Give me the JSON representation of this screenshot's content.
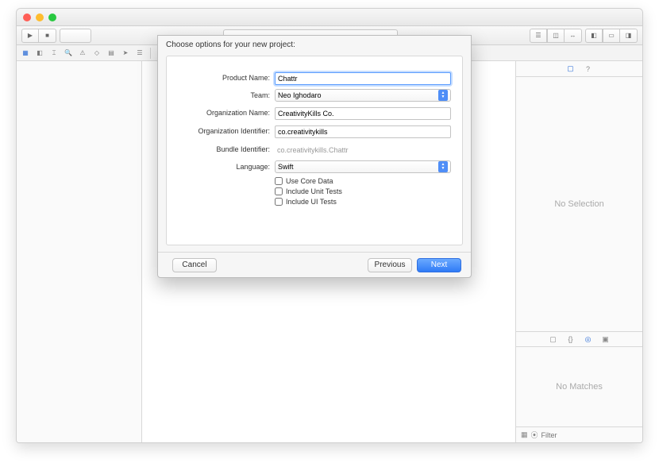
{
  "sheet": {
    "title": "Choose options for your new project:",
    "fields": {
      "productName": {
        "label": "Product Name:",
        "value": "Chattr"
      },
      "team": {
        "label": "Team:",
        "value": "Neo Ighodaro"
      },
      "orgName": {
        "label": "Organization Name:",
        "value": "CreativityKills Co."
      },
      "orgId": {
        "label": "Organization Identifier:",
        "value": "co.creativitykills"
      },
      "bundleId": {
        "label": "Bundle Identifier:",
        "value": "co.creativitykills.Chattr"
      },
      "language": {
        "label": "Language:",
        "value": "Swift"
      }
    },
    "checkboxes": {
      "coreData": "Use Core Data",
      "unitTests": "Include Unit Tests",
      "uiTests": "Include UI Tests"
    },
    "buttons": {
      "cancel": "Cancel",
      "previous": "Previous",
      "next": "Next"
    }
  },
  "inspector": {
    "noSelection": "No Selection",
    "noMatches": "No Matches",
    "filterPlaceholder": "Filter"
  }
}
